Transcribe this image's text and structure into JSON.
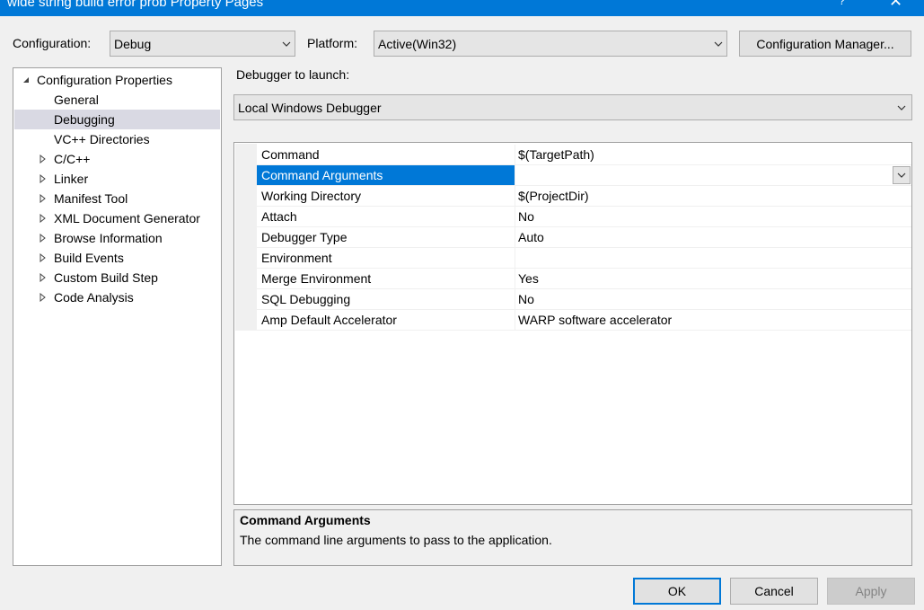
{
  "window": {
    "title": "wide string build error prob Property Pages",
    "help_glyph": "?",
    "close_glyph": "✕"
  },
  "top": {
    "configuration_label": "Configuration:",
    "configuration_value": "Debug",
    "platform_label": "Platform:",
    "platform_value": "Active(Win32)",
    "config_manager_button": "Configuration Manager..."
  },
  "tree": {
    "items": [
      {
        "label": "Configuration Properties",
        "expander": "expanded"
      },
      {
        "label": "General",
        "expander": "none"
      },
      {
        "label": "Debugging",
        "expander": "none",
        "selected": true
      },
      {
        "label": "VC++ Directories",
        "expander": "none"
      },
      {
        "label": "C/C++",
        "expander": "collapsed"
      },
      {
        "label": "Linker",
        "expander": "collapsed"
      },
      {
        "label": "Manifest Tool",
        "expander": "collapsed"
      },
      {
        "label": "XML Document Generator",
        "expander": "collapsed"
      },
      {
        "label": "Browse Information",
        "expander": "collapsed"
      },
      {
        "label": "Build Events",
        "expander": "collapsed"
      },
      {
        "label": "Custom Build Step",
        "expander": "collapsed"
      },
      {
        "label": "Code Analysis",
        "expander": "collapsed"
      }
    ]
  },
  "debugger": {
    "label": "Debugger to launch:",
    "value": "Local Windows Debugger"
  },
  "properties": [
    {
      "name": "Command",
      "value": "$(TargetPath)"
    },
    {
      "name": "Command Arguments",
      "value": "",
      "selected": true
    },
    {
      "name": "Working Directory",
      "value": "$(ProjectDir)"
    },
    {
      "name": "Attach",
      "value": "No"
    },
    {
      "name": "Debugger Type",
      "value": "Auto"
    },
    {
      "name": "Environment",
      "value": ""
    },
    {
      "name": "Merge Environment",
      "value": "Yes"
    },
    {
      "name": "SQL Debugging",
      "value": "No"
    },
    {
      "name": "Amp Default Accelerator",
      "value": "WARP software accelerator"
    }
  ],
  "description": {
    "title": "Command Arguments",
    "text": "The command line arguments to pass to the application."
  },
  "buttons": {
    "ok": "OK",
    "cancel": "Cancel",
    "apply": "Apply"
  },
  "colors": {
    "accent": "#0078d7",
    "selection_tree": "#d9d9e3",
    "dialog_bg": "#f0f0f0"
  }
}
